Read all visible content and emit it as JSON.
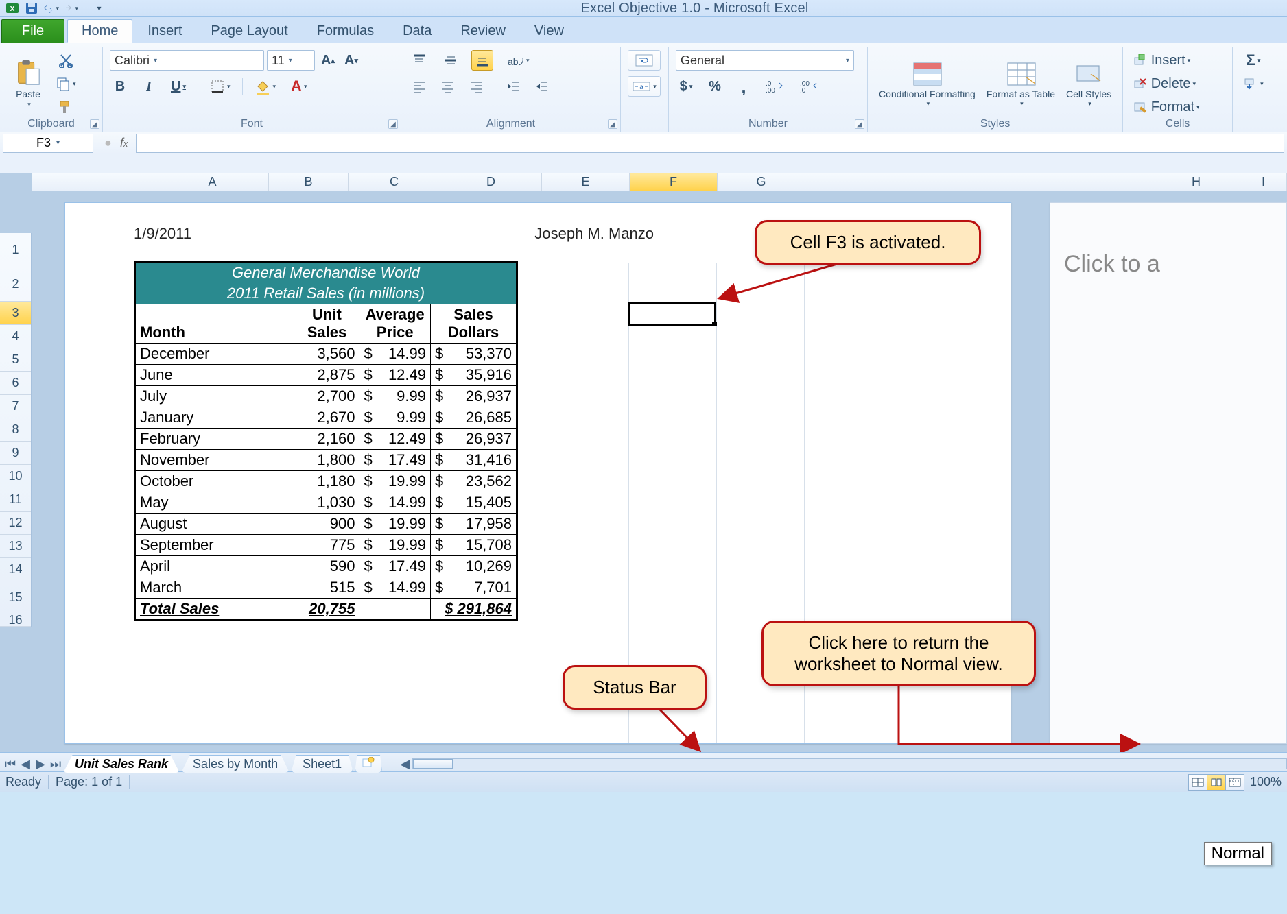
{
  "title": "Excel Objective 1.0 - Microsoft Excel",
  "tabs": {
    "file": "File",
    "list": [
      "Home",
      "Insert",
      "Page Layout",
      "Formulas",
      "Data",
      "Review",
      "View"
    ],
    "active": "Home"
  },
  "ribbon": {
    "clipboard": {
      "label": "Clipboard",
      "paste": "Paste"
    },
    "font": {
      "label": "Font",
      "name": "Calibri",
      "size": "11",
      "bold": "B",
      "italic": "I",
      "underline": "U"
    },
    "alignment": {
      "label": "Alignment"
    },
    "number": {
      "label": "Number",
      "format": "General"
    },
    "styles": {
      "label": "Styles",
      "conditional": "Conditional Formatting",
      "formatAs": "Format as Table",
      "cellStyles": "Cell Styles"
    },
    "cells": {
      "label": "Cells",
      "insert": "Insert",
      "delete": "Delete",
      "format": "Format"
    }
  },
  "formulaBar": {
    "cellRef": "F3",
    "formula": ""
  },
  "columns": [
    "A",
    "B",
    "C",
    "D",
    "E",
    "F",
    "G"
  ],
  "columnsRight": [
    "H",
    "I"
  ],
  "rows": [
    "1",
    "2",
    "3",
    "4",
    "5",
    "6",
    "7",
    "8",
    "9",
    "10",
    "11",
    "12",
    "13",
    "14",
    "15",
    "16"
  ],
  "pageHeader": {
    "date": "1/9/2011",
    "author": "Joseph M. Manzo"
  },
  "tableTitle1": "General Merchandise World",
  "tableTitle2": "2011 Retail Sales (in millions)",
  "headers": {
    "month": "Month",
    "units": "Unit Sales",
    "price": "Average Price",
    "dollars": "Sales Dollars"
  },
  "rowsData": [
    {
      "m": "December",
      "u": "3,560",
      "p": "14.99",
      "d": "53,370"
    },
    {
      "m": "June",
      "u": "2,875",
      "p": "12.49",
      "d": "35,916"
    },
    {
      "m": "July",
      "u": "2,700",
      "p": "9.99",
      "d": "26,937"
    },
    {
      "m": "January",
      "u": "2,670",
      "p": "9.99",
      "d": "26,685"
    },
    {
      "m": "February",
      "u": "2,160",
      "p": "12.49",
      "d": "26,937"
    },
    {
      "m": "November",
      "u": "1,800",
      "p": "17.49",
      "d": "31,416"
    },
    {
      "m": "October",
      "u": "1,180",
      "p": "19.99",
      "d": "23,562"
    },
    {
      "m": "May",
      "u": "1,030",
      "p": "14.99",
      "d": "15,405"
    },
    {
      "m": "August",
      "u": "900",
      "p": "19.99",
      "d": "17,958"
    },
    {
      "m": "September",
      "u": "775",
      "p": "19.99",
      "d": "15,708"
    },
    {
      "m": "April",
      "u": "590",
      "p": "17.49",
      "d": "10,269"
    },
    {
      "m": "March",
      "u": "515",
      "p": "14.99",
      "d": "7,701"
    }
  ],
  "total": {
    "label": "Total Sales",
    "units": "20,755",
    "dollars": "$   291,864"
  },
  "currency": "$",
  "page2Hint": "Click to a",
  "sheetTabs": [
    "Unit Sales Rank",
    "Sales by Month",
    "Sheet1"
  ],
  "statusBar": {
    "ready": "Ready",
    "page": "Page: 1 of 1",
    "zoom": "100%",
    "normalTip": "Normal"
  },
  "callouts": {
    "f3": "Cell F3 is activated.",
    "status": "Status Bar",
    "normalView": "Click here to return the worksheet to Normal view."
  }
}
